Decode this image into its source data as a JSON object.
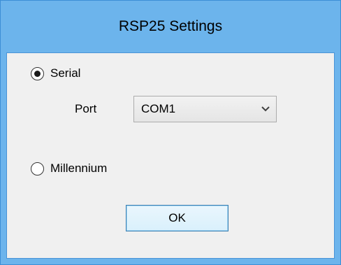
{
  "window": {
    "title": "RSP25 Settings"
  },
  "connection": {
    "options": [
      {
        "label": "Serial",
        "checked": true
      },
      {
        "label": "Millennium",
        "checked": false
      }
    ]
  },
  "port": {
    "label": "Port",
    "selected": "COM1",
    "dropdown_icon": "chevron-down-icon"
  },
  "buttons": {
    "ok_label": "OK"
  },
  "colors": {
    "frame": "#6cb4ec",
    "client_background": "#f0f0f0",
    "button_border": "#3c7fb1"
  }
}
